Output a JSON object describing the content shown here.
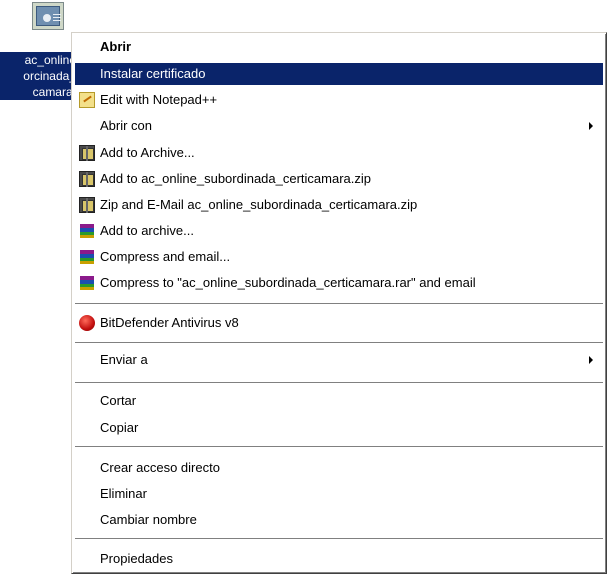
{
  "desktop_icon": {
    "label_lines": [
      "ac_online",
      "orcinada_",
      "camara."
    ],
    "icon": "certificate-icon"
  },
  "menu": {
    "items": [
      {
        "label": "Abrir",
        "bold": true
      },
      {
        "label": "Instalar certificado",
        "selected": true
      },
      {
        "label": "Edit with Notepad++",
        "icon": "notepad-plus-icon"
      },
      {
        "label": "Abrir con",
        "submenu": true
      },
      {
        "label": "Add to Archive...",
        "icon": "winzip-icon"
      },
      {
        "label": "Add to ac_online_subordinada_certicamara.zip",
        "icon": "winzip-icon"
      },
      {
        "label": "Zip and E-Mail ac_online_subordinada_certicamara.zip",
        "icon": "winzip-icon"
      },
      {
        "label": "Add to archive...",
        "icon": "winrar-icon"
      },
      {
        "label": "Compress and email...",
        "icon": "winrar-icon"
      },
      {
        "label": "Compress to \"ac_online_subordinada_certicamara.rar\" and email",
        "icon": "winrar-icon"
      },
      {
        "label": "BitDefender Antivirus v8",
        "icon": "bitdefender-icon"
      },
      {
        "label": "Enviar a",
        "submenu": true
      },
      {
        "label": "Cortar"
      },
      {
        "label": "Copiar"
      },
      {
        "label": "Crear acceso directo"
      },
      {
        "label": "Eliminar"
      },
      {
        "label": "Cambiar nombre"
      },
      {
        "label": "Propiedades"
      }
    ]
  },
  "colors": {
    "selection": "#0a246a",
    "menu_background": "#ffffff"
  }
}
